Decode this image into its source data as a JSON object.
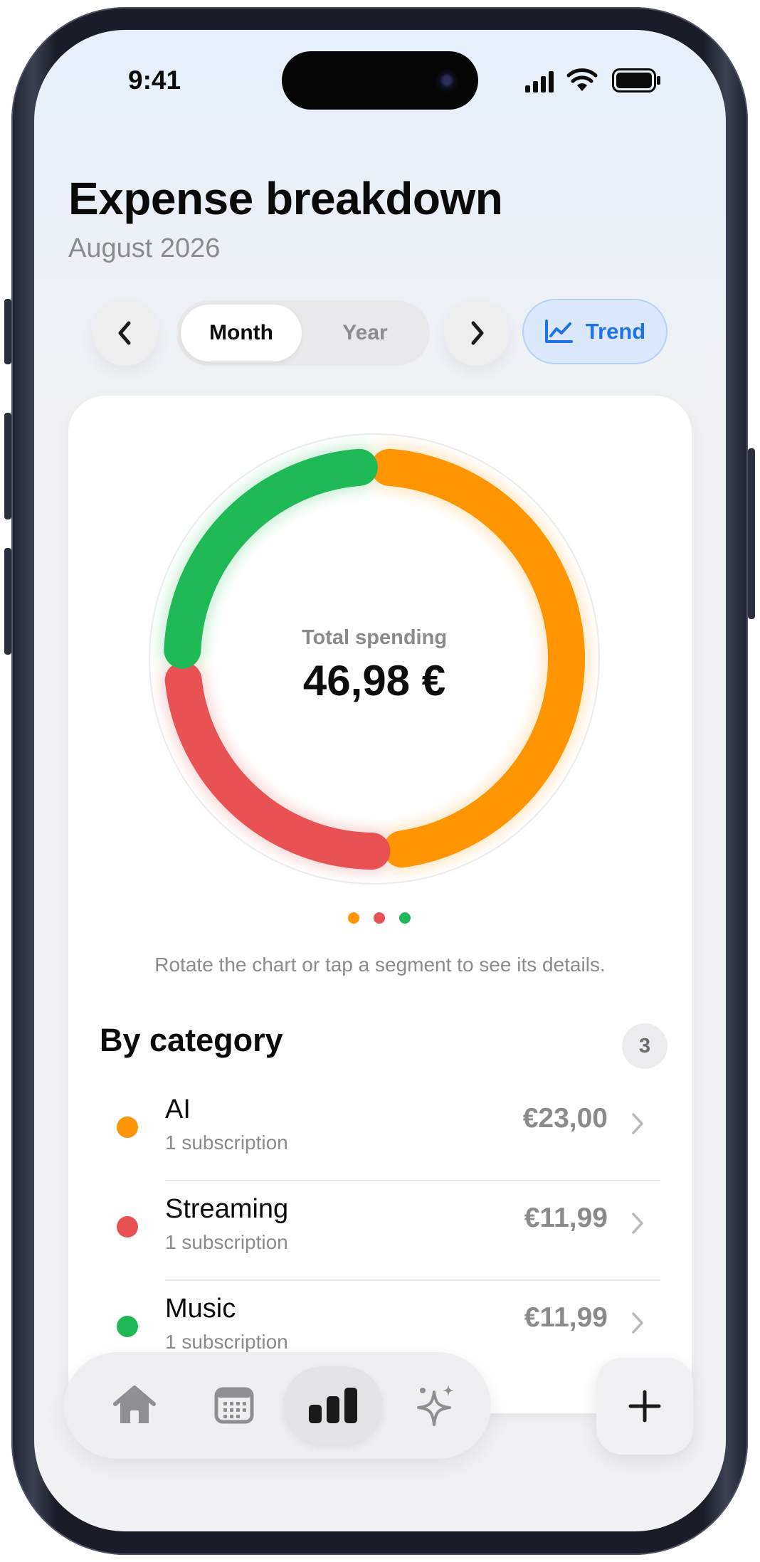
{
  "status_bar": {
    "time": "9:41"
  },
  "header": {
    "title": "Expense breakdown",
    "subtitle": "August 2026"
  },
  "controls": {
    "period_options": [
      "Month",
      "Year"
    ],
    "selected_period": "Month",
    "trend_label": "Trend"
  },
  "summary": {
    "label": "Total spending",
    "value": "46,98 €"
  },
  "chart_data": {
    "type": "pie",
    "style": "donut",
    "series": [
      {
        "name": "AI",
        "value": 23.0,
        "color": "#ff9500"
      },
      {
        "name": "Streaming",
        "value": 11.99,
        "color": "#e85252"
      },
      {
        "name": "Music",
        "value": 11.99,
        "color": "#1fba55"
      }
    ]
  },
  "page_indicator_colors": [
    "#ff9500",
    "#e85252",
    "#1fba55"
  ],
  "hint": "Rotate the chart or tap a segment to see its details.",
  "categories": {
    "title": "By category",
    "count": "3",
    "items": [
      {
        "name": "AI",
        "sub": "1 subscription",
        "amount": "€23,00",
        "color": "#ff9500"
      },
      {
        "name": "Streaming",
        "sub": "1 subscription",
        "amount": "€11,99",
        "color": "#e85252"
      },
      {
        "name": "Music",
        "sub": "1 subscription",
        "amount": "€11,99",
        "color": "#1fba55"
      }
    ]
  },
  "tabbar": {
    "tabs": [
      {
        "icon": "home-icon",
        "active": false
      },
      {
        "icon": "calendar-icon",
        "active": false
      },
      {
        "icon": "bar-chart-icon",
        "active": true
      },
      {
        "icon": "sparkles-icon",
        "active": false
      }
    ],
    "fab_icon": "plus-icon"
  }
}
